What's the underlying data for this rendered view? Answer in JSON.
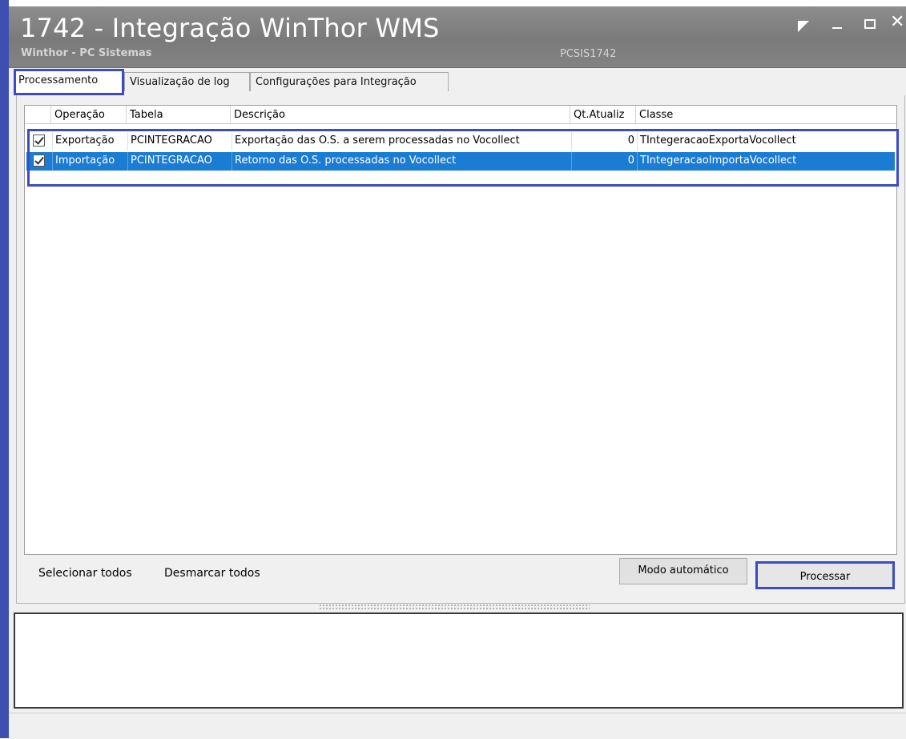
{
  "window": {
    "title": "1742 - Integração WinThor WMS",
    "subtitle": "Winthor - PC Sistemas",
    "app_code": "PCSIS1742",
    "controls": [
      "restore-icon",
      "minimize-icon",
      "maximize-icon",
      "close-icon"
    ],
    "close_glyph": "✕"
  },
  "tabs": [
    {
      "label": "Processamento",
      "active": true
    },
    {
      "label": "Visualização de log",
      "active": false
    },
    {
      "label": "Configurações para Integração",
      "active": false
    }
  ],
  "grid": {
    "columns": [
      "Operação",
      "Tabela",
      "Descrição",
      "Qt.Atualiz",
      "Classe"
    ],
    "rows": [
      {
        "checked": true,
        "operacao": "Exportação",
        "tabela": "PCINTEGRACAO",
        "descricao": "Exportação das O.S. a serem processadas no Vocollect",
        "qt": "0",
        "classe": "TIntegeracaoExportaVocollect",
        "selected": false
      },
      {
        "checked": true,
        "operacao": "Importação",
        "tabela": "PCINTEGRACAO",
        "descricao": "Retorno das O.S. processadas no Vocollect",
        "qt": "0",
        "classe": "TIntegeracaoImportaVocollect",
        "selected": true
      }
    ]
  },
  "actions": {
    "select_all": "Selecionar todos",
    "deselect_all": "Desmarcar todos",
    "auto_mode": "Modo automático",
    "process": "Processar"
  },
  "colors": {
    "highlight_border": "#3b4cc0",
    "selected_row": "#1b7cd3",
    "titlebar": "#808080"
  }
}
